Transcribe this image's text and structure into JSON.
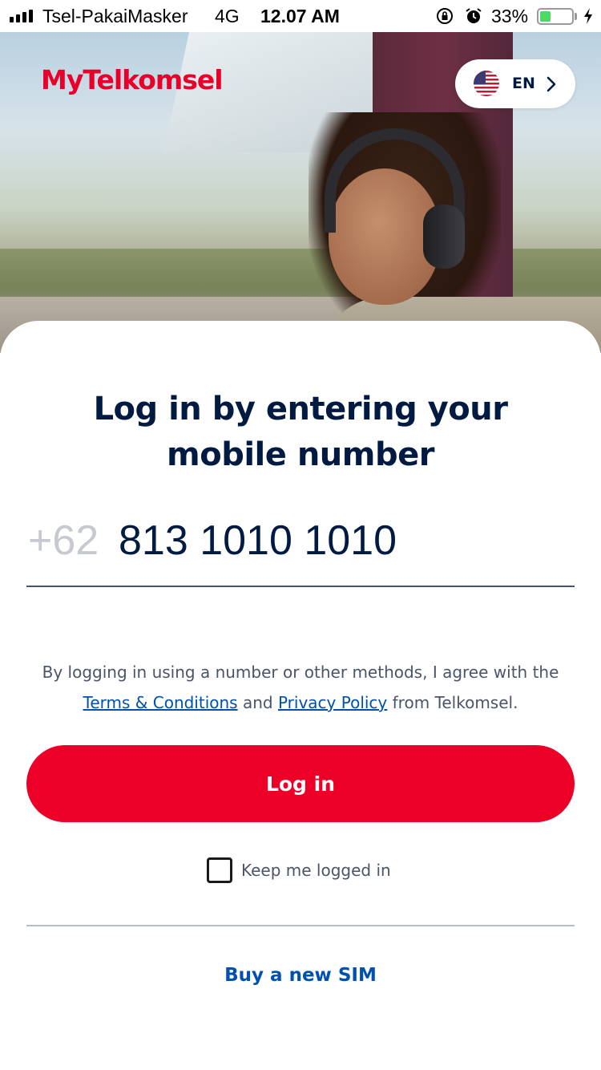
{
  "status_bar": {
    "carrier": "Tsel-PakaiMasker",
    "network": "4G",
    "time": "12.07 AM",
    "battery_percent": "33%",
    "battery_level": 0.33,
    "icons": [
      "signal-icon",
      "orientation-lock-icon",
      "alarm-icon",
      "battery-icon",
      "charging-icon"
    ]
  },
  "header": {
    "logo": "MyTelkomsel",
    "language": {
      "code": "EN",
      "flag_icon": "us-flag-icon",
      "chevron_icon": "chevron-right-icon"
    }
  },
  "login": {
    "title": "Log in by entering your mobile number",
    "country_code": "+62",
    "phone_number": "813 1010 1010",
    "agreement_prefix": "By logging in using a number or other methods, I agree with the",
    "terms_link": "Terms & Conditions",
    "agreement_and": "and",
    "privacy_link": "Privacy Policy",
    "agreement_suffix": "from Telkomsel.",
    "login_button": "Log in",
    "keep_logged_in_label": "Keep me logged in",
    "keep_logged_in_checked": false,
    "buy_sim_link": "Buy a new SIM"
  },
  "colors": {
    "brand_red": "#ec0028",
    "link_blue": "#0050ae",
    "navy_text": "#001a41"
  }
}
